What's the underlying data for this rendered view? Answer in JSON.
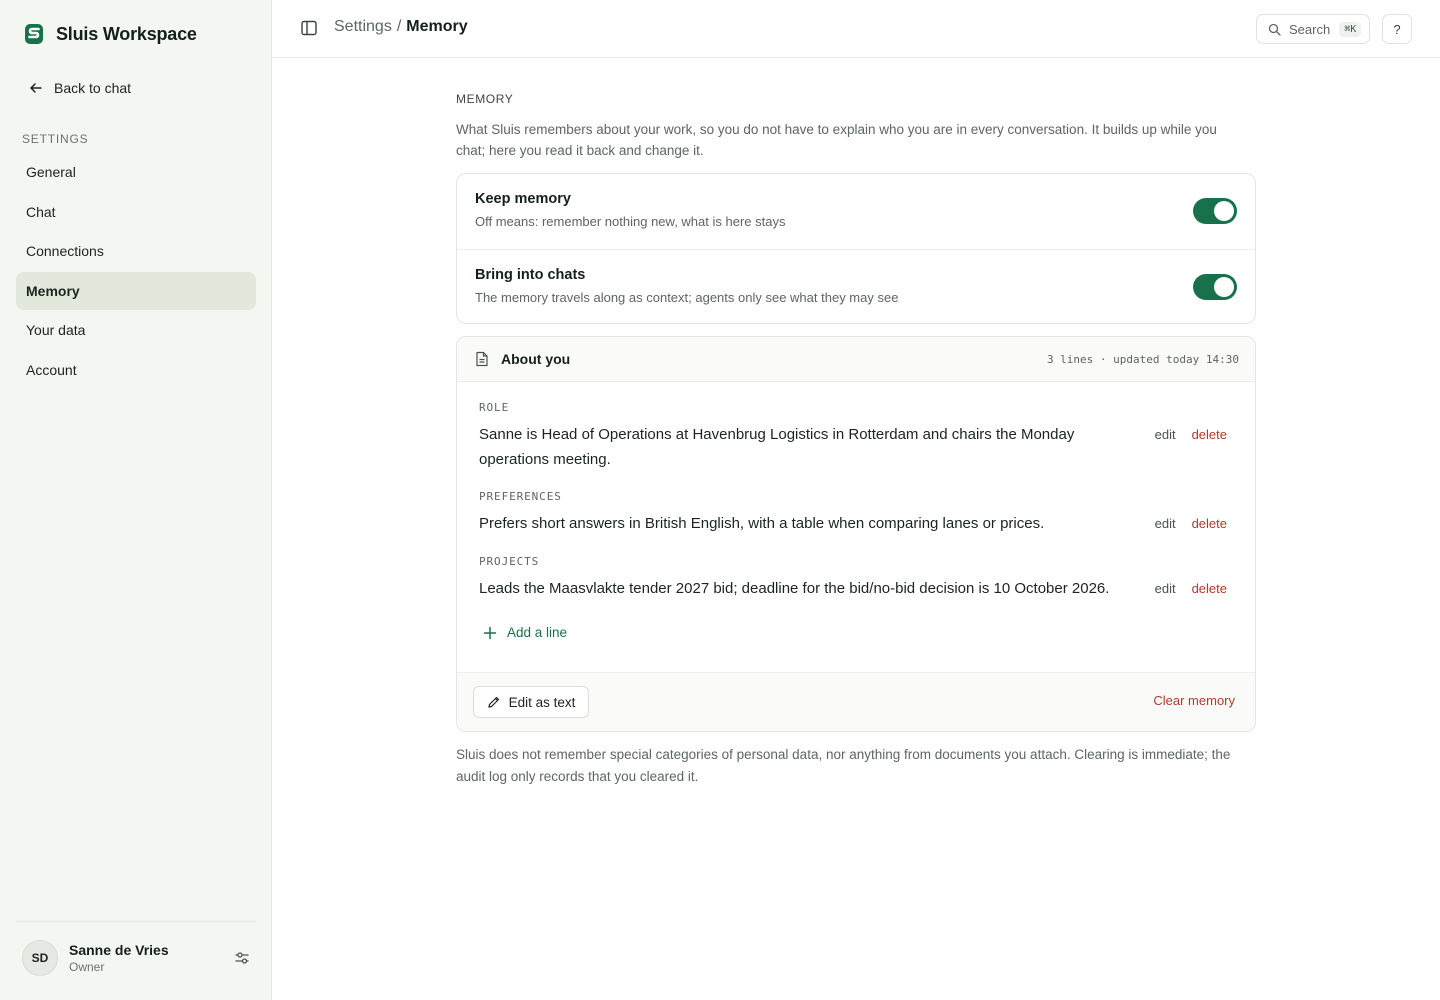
{
  "app": {
    "name": "Sluis Workspace",
    "brand_color": "#17724b"
  },
  "sidebar": {
    "back_label": "Back to chat",
    "section_label": "SETTINGS",
    "items": [
      {
        "label": "General",
        "active": false
      },
      {
        "label": "Chat",
        "active": false
      },
      {
        "label": "Connections",
        "active": false
      },
      {
        "label": "Memory",
        "active": true
      },
      {
        "label": "Your data",
        "active": false
      },
      {
        "label": "Account",
        "active": false
      }
    ],
    "user": {
      "initials": "SD",
      "name": "Sanne de Vries",
      "role": "Owner"
    }
  },
  "topbar": {
    "breadcrumb_parent": "Settings",
    "breadcrumb_separator": "/",
    "breadcrumb_current": "Memory",
    "search_label": "Search",
    "search_shortcut": "⌘K",
    "help_label": "?"
  },
  "page": {
    "heading": "MEMORY",
    "description": "What Sluis remembers about your work, so you do not have to explain who you are in every conversation. It builds up while you chat; here you read it back and change it.",
    "toggles": [
      {
        "title": "Keep memory",
        "subtitle": "Off means: remember nothing new, what is here stays",
        "enabled": true
      },
      {
        "title": "Bring into chats",
        "subtitle": "The memory travels along as context; agents only see what they may see",
        "enabled": true
      }
    ],
    "about": {
      "title": "About you",
      "meta": "3 lines · updated today 14:30",
      "entries": [
        {
          "label": "ROLE",
          "text": "Sanne is Head of Operations at Havenbrug Logistics in Rotterdam and chairs the Monday operations meeting."
        },
        {
          "label": "PREFERENCES",
          "text": "Prefers short answers in British English, with a table when comparing lanes or prices."
        },
        {
          "label": "PROJECTS",
          "text": "Leads the Maasvlakte tender 2027 bid; deadline for the bid/no-bid decision is 10 October 2026."
        }
      ],
      "edit_label": "edit",
      "delete_label": "delete",
      "add_line_label": "Add a line",
      "edit_as_text_label": "Edit as text",
      "clear_label": "Clear memory"
    },
    "footnote": "Sluis does not remember special categories of personal data, nor anything from documents you attach. Clearing is immediate; the audit log only records that you cleared it."
  }
}
